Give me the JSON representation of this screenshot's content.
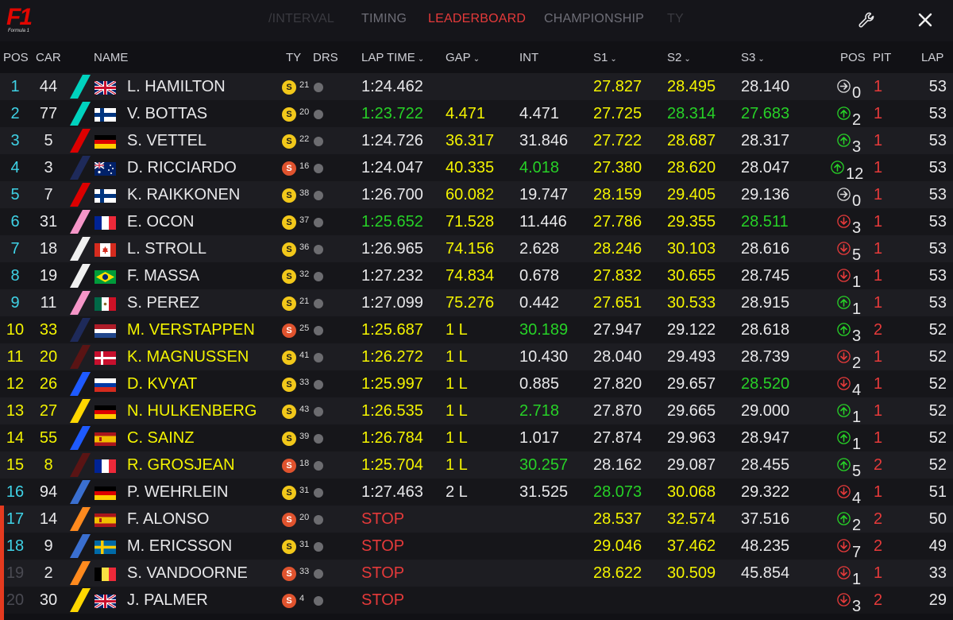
{
  "app": {
    "logo_text": "F1",
    "logo_sub": "Formula 1"
  },
  "tabs": [
    {
      "label": "/INTERVAL",
      "state": "fade"
    },
    {
      "label": "TIMING",
      "state": "normal"
    },
    {
      "label": "LEADERBOARD",
      "state": "active"
    },
    {
      "label": "CHAMPIONSHIP",
      "state": "normal"
    },
    {
      "label": "TY",
      "state": "fade"
    }
  ],
  "toolbar": {
    "settings_icon": "wrench-icon",
    "close_icon": "close-icon"
  },
  "columns": {
    "pos": "POS",
    "car": "CAR",
    "name": "NAME",
    "ty": "TY",
    "drs": "DRS",
    "lap_time": "LAP TIME",
    "gap": "GAP",
    "int": "INT",
    "s1": "S1",
    "s2": "S2",
    "s3": "S3",
    "pos_change": "POS",
    "pit": "PIT",
    "lap": "LAP"
  },
  "colors": {
    "yellow": "#f4f400",
    "green": "#27d127",
    "white": "#e8e8ea",
    "red": "#e53a3a",
    "cyan": "#3fd2e6",
    "tyre_super_soft": "#e0532e",
    "tyre_soft": "#f2c81a"
  },
  "rows": [
    {
      "pos": "1",
      "car": "44",
      "team": "#00d2be",
      "flag": "gb",
      "name": "L. HAMILTON",
      "tyre": "S",
      "tyre_type": "soft",
      "age": "21",
      "lap": "1:24.462",
      "lap_c": "wht",
      "gap": "",
      "gap_c": "yel",
      "int": "",
      "int_c": "wht",
      "s1": "27.827",
      "s1_c": "yel",
      "s2": "28.495",
      "s2_c": "yel",
      "s3": "28.140",
      "s3_c": "wht",
      "dir": "same",
      "chg": "0",
      "pit": "1",
      "laps": "53",
      "pos_c": "cyan",
      "car_c": "wht",
      "name_c": "wht"
    },
    {
      "pos": "2",
      "car": "77",
      "team": "#00d2be",
      "flag": "fi",
      "name": "V. BOTTAS",
      "tyre": "S",
      "tyre_type": "soft",
      "age": "20",
      "lap": "1:23.722",
      "lap_c": "grn",
      "gap": "4.471",
      "gap_c": "yel",
      "int": "4.471",
      "int_c": "wht",
      "s1": "27.725",
      "s1_c": "yel",
      "s2": "28.314",
      "s2_c": "grn",
      "s3": "27.683",
      "s3_c": "grn",
      "dir": "up",
      "chg": "2",
      "pit": "1",
      "laps": "53",
      "pos_c": "cyan",
      "car_c": "wht",
      "name_c": "wht"
    },
    {
      "pos": "3",
      "car": "5",
      "team": "#dc0000",
      "flag": "de",
      "name": "S. VETTEL",
      "tyre": "S",
      "tyre_type": "soft",
      "age": "22",
      "lap": "1:24.726",
      "lap_c": "wht",
      "gap": "36.317",
      "gap_c": "yel",
      "int": "31.846",
      "int_c": "wht",
      "s1": "27.722",
      "s1_c": "yel",
      "s2": "28.687",
      "s2_c": "yel",
      "s3": "28.317",
      "s3_c": "wht",
      "dir": "up",
      "chg": "3",
      "pit": "1",
      "laps": "53",
      "pos_c": "cyan",
      "car_c": "wht",
      "name_c": "wht"
    },
    {
      "pos": "4",
      "car": "3",
      "team": "#1e2a5a",
      "flag": "au",
      "name": "D. RICCIARDO",
      "tyre": "S",
      "tyre_type": "supersoft",
      "age": "16",
      "lap": "1:24.047",
      "lap_c": "wht",
      "gap": "40.335",
      "gap_c": "yel",
      "int": "4.018",
      "int_c": "grn",
      "s1": "27.380",
      "s1_c": "yel",
      "s2": "28.620",
      "s2_c": "yel",
      "s3": "28.047",
      "s3_c": "wht",
      "dir": "up",
      "chg": "12",
      "pit": "1",
      "laps": "53",
      "pos_c": "cyan",
      "car_c": "wht",
      "name_c": "wht"
    },
    {
      "pos": "5",
      "car": "7",
      "team": "#dc0000",
      "flag": "fi",
      "name": "K. RAIKKONEN",
      "tyre": "S",
      "tyre_type": "soft",
      "age": "38",
      "lap": "1:26.700",
      "lap_c": "wht",
      "gap": "60.082",
      "gap_c": "yel",
      "int": "19.747",
      "int_c": "wht",
      "s1": "28.159",
      "s1_c": "yel",
      "s2": "29.405",
      "s2_c": "yel",
      "s3": "29.136",
      "s3_c": "wht",
      "dir": "same",
      "chg": "0",
      "pit": "1",
      "laps": "53",
      "pos_c": "cyan",
      "car_c": "wht",
      "name_c": "wht"
    },
    {
      "pos": "6",
      "car": "31",
      "team": "#f596c8",
      "flag": "fr",
      "name": "E. OCON",
      "tyre": "S",
      "tyre_type": "soft",
      "age": "37",
      "lap": "1:25.652",
      "lap_c": "grn",
      "gap": "71.528",
      "gap_c": "yel",
      "int": "11.446",
      "int_c": "wht",
      "s1": "27.786",
      "s1_c": "yel",
      "s2": "29.355",
      "s2_c": "yel",
      "s3": "28.511",
      "s3_c": "grn",
      "dir": "down",
      "chg": "3",
      "pit": "1",
      "laps": "53",
      "pos_c": "cyan",
      "car_c": "wht",
      "name_c": "wht"
    },
    {
      "pos": "7",
      "car": "18",
      "team": "#f0f0f0",
      "flag": "ca",
      "name": "L. STROLL",
      "tyre": "S",
      "tyre_type": "soft",
      "age": "36",
      "lap": "1:26.965",
      "lap_c": "wht",
      "gap": "74.156",
      "gap_c": "yel",
      "int": "2.628",
      "int_c": "wht",
      "s1": "28.246",
      "s1_c": "yel",
      "s2": "30.103",
      "s2_c": "yel",
      "s3": "28.616",
      "s3_c": "wht",
      "dir": "down",
      "chg": "5",
      "pit": "1",
      "laps": "53",
      "pos_c": "cyan",
      "car_c": "wht",
      "name_c": "wht"
    },
    {
      "pos": "8",
      "car": "19",
      "team": "#f0f0f0",
      "flag": "br",
      "name": "F. MASSA",
      "tyre": "S",
      "tyre_type": "soft",
      "age": "32",
      "lap": "1:27.232",
      "lap_c": "wht",
      "gap": "74.834",
      "gap_c": "yel",
      "int": "0.678",
      "int_c": "wht",
      "s1": "27.832",
      "s1_c": "yel",
      "s2": "30.655",
      "s2_c": "yel",
      "s3": "28.745",
      "s3_c": "wht",
      "dir": "down",
      "chg": "1",
      "pit": "1",
      "laps": "53",
      "pos_c": "cyan",
      "car_c": "wht",
      "name_c": "wht"
    },
    {
      "pos": "9",
      "car": "11",
      "team": "#f596c8",
      "flag": "mx",
      "name": "S. PEREZ",
      "tyre": "S",
      "tyre_type": "soft",
      "age": "21",
      "lap": "1:27.099",
      "lap_c": "wht",
      "gap": "75.276",
      "gap_c": "yel",
      "int": "0.442",
      "int_c": "wht",
      "s1": "27.651",
      "s1_c": "yel",
      "s2": "30.533",
      "s2_c": "yel",
      "s3": "28.915",
      "s3_c": "wht",
      "dir": "up",
      "chg": "1",
      "pit": "1",
      "laps": "53",
      "pos_c": "cyan",
      "car_c": "wht",
      "name_c": "wht"
    },
    {
      "pos": "10",
      "car": "33",
      "team": "#1e2a5a",
      "flag": "nl",
      "name": "M. VERSTAPPEN",
      "tyre": "S",
      "tyre_type": "supersoft",
      "age": "25",
      "lap": "1:25.687",
      "lap_c": "yel",
      "gap": "1 L",
      "gap_c": "yel",
      "int": "30.189",
      "int_c": "grn",
      "s1": "27.947",
      "s1_c": "wht",
      "s2": "29.122",
      "s2_c": "wht",
      "s3": "28.618",
      "s3_c": "wht",
      "dir": "up",
      "chg": "3",
      "pit": "2",
      "laps": "52",
      "pos_c": "yel",
      "car_c": "yel",
      "name_c": "yel"
    },
    {
      "pos": "11",
      "car": "20",
      "team": "#5a1414",
      "flag": "dk",
      "name": "K. MAGNUSSEN",
      "tyre": "S",
      "tyre_type": "soft",
      "age": "41",
      "lap": "1:26.272",
      "lap_c": "yel",
      "gap": "1 L",
      "gap_c": "yel",
      "int": "10.430",
      "int_c": "wht",
      "s1": "28.040",
      "s1_c": "wht",
      "s2": "29.493",
      "s2_c": "wht",
      "s3": "28.739",
      "s3_c": "wht",
      "dir": "down",
      "chg": "2",
      "pit": "1",
      "laps": "52",
      "pos_c": "yel",
      "car_c": "yel",
      "name_c": "yel"
    },
    {
      "pos": "12",
      "car": "26",
      "team": "#1e5aff",
      "flag": "ru",
      "name": "D. KVYAT",
      "tyre": "S",
      "tyre_type": "soft",
      "age": "33",
      "lap": "1:25.997",
      "lap_c": "yel",
      "gap": "1 L",
      "gap_c": "yel",
      "int": "0.885",
      "int_c": "wht",
      "s1": "27.820",
      "s1_c": "wht",
      "s2": "29.657",
      "s2_c": "wht",
      "s3": "28.520",
      "s3_c": "grn",
      "dir": "down",
      "chg": "4",
      "pit": "1",
      "laps": "52",
      "pos_c": "yel",
      "car_c": "yel",
      "name_c": "yel"
    },
    {
      "pos": "13",
      "car": "27",
      "team": "#ffd700",
      "flag": "de",
      "name": "N. HULKENBERG",
      "tyre": "S",
      "tyre_type": "soft",
      "age": "43",
      "lap": "1:26.535",
      "lap_c": "yel",
      "gap": "1 L",
      "gap_c": "yel",
      "int": "2.718",
      "int_c": "grn",
      "s1": "27.870",
      "s1_c": "wht",
      "s2": "29.665",
      "s2_c": "wht",
      "s3": "29.000",
      "s3_c": "wht",
      "dir": "up",
      "chg": "1",
      "pit": "1",
      "laps": "52",
      "pos_c": "yel",
      "car_c": "yel",
      "name_c": "yel"
    },
    {
      "pos": "14",
      "car": "55",
      "team": "#1e5aff",
      "flag": "es",
      "name": "C. SAINZ",
      "tyre": "S",
      "tyre_type": "soft",
      "age": "39",
      "lap": "1:26.784",
      "lap_c": "yel",
      "gap": "1 L",
      "gap_c": "yel",
      "int": "1.017",
      "int_c": "wht",
      "s1": "27.874",
      "s1_c": "wht",
      "s2": "29.963",
      "s2_c": "wht",
      "s3": "28.947",
      "s3_c": "wht",
      "dir": "up",
      "chg": "1",
      "pit": "1",
      "laps": "52",
      "pos_c": "yel",
      "car_c": "yel",
      "name_c": "yel"
    },
    {
      "pos": "15",
      "car": "8",
      "team": "#5a1414",
      "flag": "fr",
      "name": "R. GROSJEAN",
      "tyre": "S",
      "tyre_type": "supersoft",
      "age": "18",
      "lap": "1:25.704",
      "lap_c": "yel",
      "gap": "1 L",
      "gap_c": "yel",
      "int": "30.257",
      "int_c": "grn",
      "s1": "28.162",
      "s1_c": "wht",
      "s2": "29.087",
      "s2_c": "wht",
      "s3": "28.455",
      "s3_c": "wht",
      "dir": "up",
      "chg": "5",
      "pit": "2",
      "laps": "52",
      "pos_c": "yel",
      "car_c": "yel",
      "name_c": "yel"
    },
    {
      "pos": "16",
      "car": "94",
      "team": "#3a6fd0",
      "flag": "de",
      "name": "P. WEHRLEIN",
      "tyre": "S",
      "tyre_type": "soft",
      "age": "31",
      "lap": "1:27.463",
      "lap_c": "wht",
      "gap": "2 L",
      "gap_c": "wht",
      "int": "31.525",
      "int_c": "wht",
      "s1": "28.073",
      "s1_c": "grn",
      "s2": "30.068",
      "s2_c": "yel",
      "s3": "29.322",
      "s3_c": "wht",
      "dir": "down",
      "chg": "4",
      "pit": "1",
      "laps": "51",
      "pos_c": "cyan",
      "car_c": "wht",
      "name_c": "wht"
    },
    {
      "pos": "17",
      "car": "14",
      "team": "#ff8a1e",
      "flag": "es",
      "name": "F. ALONSO",
      "tyre": "S",
      "tyre_type": "supersoft",
      "age": "20",
      "lap": "STOP",
      "lap_c": "red",
      "gap": "",
      "gap_c": "yel",
      "int": "",
      "int_c": "wht",
      "s1": "28.537",
      "s1_c": "yel",
      "s2": "32.574",
      "s2_c": "yel",
      "s3": "37.516",
      "s3_c": "wht",
      "dir": "up",
      "chg": "2",
      "pit": "2",
      "laps": "50",
      "pos_c": "cyan",
      "car_c": "wht",
      "name_c": "wht"
    },
    {
      "pos": "18",
      "car": "9",
      "team": "#3a6fd0",
      "flag": "se",
      "name": "M. ERICSSON",
      "tyre": "S",
      "tyre_type": "soft",
      "age": "31",
      "lap": "STOP",
      "lap_c": "red",
      "gap": "",
      "gap_c": "yel",
      "int": "",
      "int_c": "wht",
      "s1": "29.046",
      "s1_c": "yel",
      "s2": "37.462",
      "s2_c": "yel",
      "s3": "48.235",
      "s3_c": "wht",
      "dir": "down",
      "chg": "7",
      "pit": "2",
      "laps": "49",
      "pos_c": "cyan",
      "car_c": "wht",
      "name_c": "wht"
    },
    {
      "pos": "19",
      "car": "2",
      "team": "#ff8a1e",
      "flag": "be",
      "name": "S. VANDOORNE",
      "tyre": "S",
      "tyre_type": "supersoft",
      "age": "33",
      "lap": "STOP",
      "lap_c": "red",
      "gap": "",
      "gap_c": "yel",
      "int": "",
      "int_c": "wht",
      "s1": "28.622",
      "s1_c": "yel",
      "s2": "30.509",
      "s2_c": "yel",
      "s3": "45.854",
      "s3_c": "wht",
      "dir": "down",
      "chg": "1",
      "pit": "1",
      "laps": "33",
      "pos_c": "gry",
      "car_c": "wht",
      "name_c": "wht"
    },
    {
      "pos": "20",
      "car": "30",
      "team": "#ffd700",
      "flag": "gb",
      "name": "J. PALMER",
      "tyre": "S",
      "tyre_type": "supersoft",
      "age": "4",
      "lap": "STOP",
      "lap_c": "red",
      "gap": "",
      "gap_c": "yel",
      "int": "",
      "int_c": "wht",
      "s1": "",
      "s1_c": "yel",
      "s2": "",
      "s2_c": "yel",
      "s3": "",
      "s3_c": "wht",
      "dir": "down",
      "chg": "3",
      "pit": "2",
      "laps": "29",
      "pos_c": "gry",
      "car_c": "wht",
      "name_c": "wht"
    }
  ]
}
